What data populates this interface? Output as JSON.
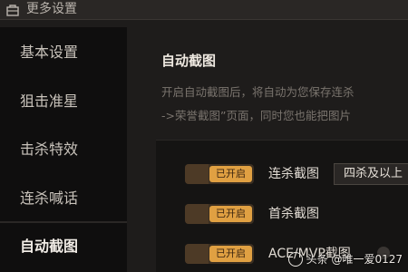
{
  "window": {
    "title": "更多设置"
  },
  "sidebar": {
    "items": [
      {
        "label": "基本设置",
        "active": false
      },
      {
        "label": "狙击准星",
        "active": false
      },
      {
        "label": "击杀特效",
        "active": false
      },
      {
        "label": "连杀喊话",
        "active": false
      },
      {
        "label": "自动截图",
        "active": true
      }
    ]
  },
  "main": {
    "section_title": "自动截图",
    "description_line1": "开启自动截图后，将自动为您保存连杀",
    "description_line2": "->荣誉截图”页面，同时您也能把图片"
  },
  "settings": {
    "rows": [
      {
        "toggle_label": "已开启",
        "label": "连杀截图",
        "select_value": "四杀及以上"
      },
      {
        "toggle_label": "已开启",
        "label": "首杀截图"
      },
      {
        "toggle_label": "已开启",
        "label": "ACE/MVP截图"
      }
    ]
  },
  "watermark": {
    "text": "头条 @唯一爱0127"
  },
  "colors": {
    "toggle_on": "#e0a042",
    "background": "#1e1c1b",
    "sidebar": "#0f0e0e"
  }
}
